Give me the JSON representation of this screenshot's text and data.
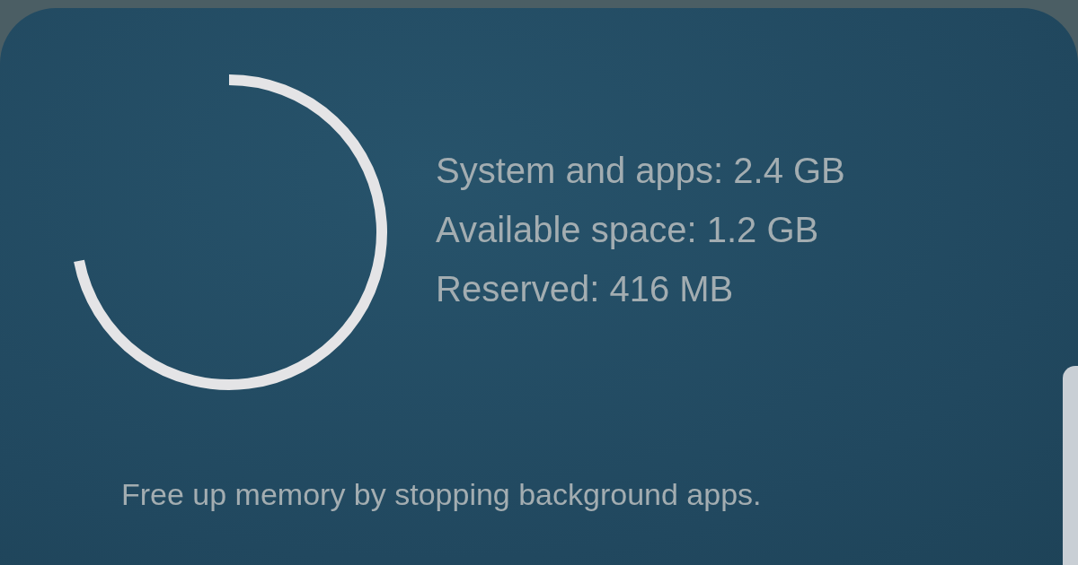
{
  "details": [
    "System and apps: 2.4 GB",
    "Available space: 1.2 GB",
    "Reserved: 416 MB"
  ],
  "hint": "Free up memory by stopping background apps."
}
